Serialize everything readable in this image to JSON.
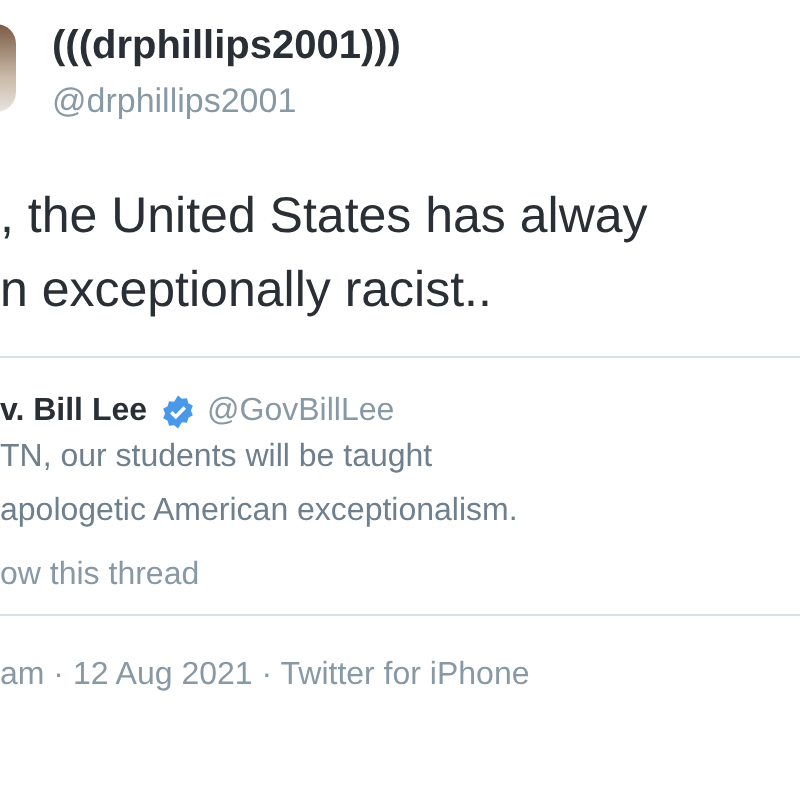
{
  "author": {
    "name": "(((drphillips2001)))",
    "handle": "@drphillips2001"
  },
  "text_lines": [
    ", the United States has alway",
    "n exceptionally racist.."
  ],
  "quoted": {
    "name": "v. Bill Lee",
    "verified": true,
    "handle": "@GovBillLee",
    "text_lines": [
      "TN, our students will be taught",
      "apologetic American exceptionalism."
    ],
    "thread_link": "ow this thread"
  },
  "footer": "am · 12 Aug 2021 · Twitter for iPhone"
}
